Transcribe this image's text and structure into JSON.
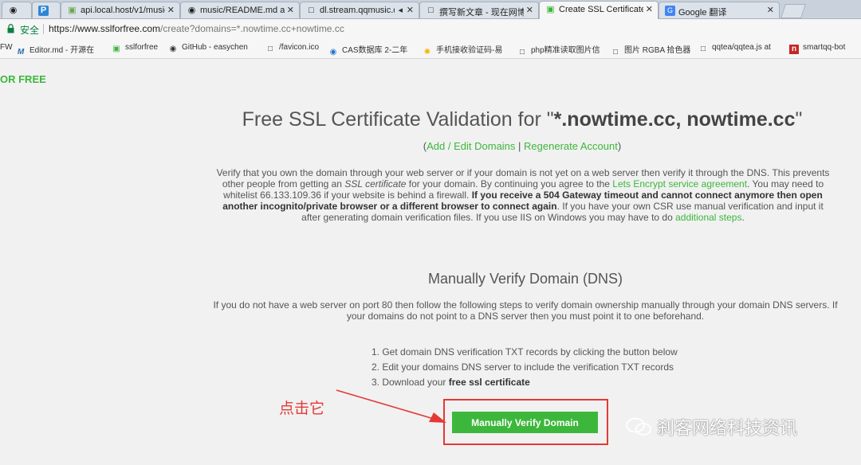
{
  "tabs": [
    {
      "label": "",
      "icon": "github-icon",
      "active": false
    },
    {
      "label": "",
      "icon": "p-app-icon",
      "active": false
    },
    {
      "label": "api.local.host/v1/music",
      "icon": "page-icon",
      "active": false
    },
    {
      "label": "music/README.md at",
      "icon": "github-icon",
      "active": false
    },
    {
      "label": "dl.stream.qqmusic.q",
      "icon": "page-icon",
      "active": false
    },
    {
      "label": "撰写新文章 - 现在网博客",
      "icon": "page-icon",
      "active": false
    },
    {
      "label": "Create SSL Certificate",
      "icon": "page-icon",
      "active": true
    },
    {
      "label": "Google 翻译",
      "icon": "translate-icon",
      "active": false
    }
  ],
  "address_bar": {
    "secure_label": "安全",
    "url_base": "https://www.sslforfree.com",
    "url_rest": "/create?domains=*.nowtime.cc+nowtime.cc"
  },
  "bookmarks": [
    {
      "label": "FW",
      "icon": "none"
    },
    {
      "label": "Editor.md - 开源在",
      "icon": "m-icon"
    },
    {
      "label": "sslforfree",
      "icon": "lock-icon"
    },
    {
      "label": "GitHub - easychen",
      "icon": "github-icon"
    },
    {
      "label": "/favicon.ico",
      "icon": "page-icon"
    },
    {
      "label": "CAS数据库 2-二年",
      "icon": "cas-icon"
    },
    {
      "label": "手机接收验证码-易",
      "icon": "chrome-icon"
    },
    {
      "label": "php精准读取图片信",
      "icon": "page-icon"
    },
    {
      "label": "图片 RGBA 拾色器",
      "icon": "page-icon"
    },
    {
      "label": "qqtea/qqtea.js at",
      "icon": "page-icon"
    },
    {
      "label": "smartqq-bot",
      "icon": "n-icon"
    }
  ],
  "page": {
    "brand": "OR FREE",
    "title_prefix": "Free SSL Certificate Validation for \"",
    "title_domains": "*.nowtime.cc, nowtime.cc",
    "title_suffix": "\"",
    "link_open": "(",
    "link_edit": "Add / Edit Domains",
    "link_sep": " | ",
    "link_regen": "Regenerate Account",
    "link_close": ")",
    "para": {
      "t1": "Verify that you own the domain through your web server or if your domain is not yet on a web server then verify it through the DNS. This prevents other people from getting an ",
      "t2": "SSL certificate",
      "t3": " for your domain. By continuing you agree to the ",
      "t4": "Lets Encrypt service agreement",
      "t5": ". You may need to whitelist 66.133.109.36 if your website is behind a firewall. ",
      "t6": "If you receive a 504 Gateway timeout and cannot connect anymore then open another incognito/private browser or a different browser to connect again",
      "t7": ". If you have your own CSR use manual verification and input it after generating domain verification files. If you use IIS on Windows you may have to do ",
      "t8": "additional steps",
      "t9": "."
    },
    "dns_heading": "Manually Verify Domain (DNS)",
    "dns_para": "If you do not have a web server on port 80 then follow the following steps to verify domain ownership manually through your domain DNS servers. If your domains do not point to a DNS server then you must point it to one beforehand.",
    "steps": {
      "s1": "1. Get domain DNS verification TXT records by clicking the button below",
      "s2": "2. Edit your domains DNS server to include the verification TXT records",
      "s3_prefix": "3. Download your ",
      "s3_bold": "free ssl certificate"
    },
    "verify_button": "Manually Verify Domain"
  },
  "annotation": {
    "text": "点击它",
    "color": "#e53935"
  },
  "watermark": {
    "text": "刹客网络科技资讯"
  },
  "colors": {
    "accent": "#3cb73b",
    "annotation_red": "#e53935"
  }
}
